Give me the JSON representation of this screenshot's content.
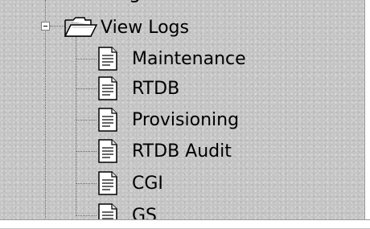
{
  "tree": {
    "clipped_above": "g",
    "folder": {
      "label": "View Logs",
      "icon": "open-folder-icon",
      "expander_icon": "collapse-minus-icon",
      "expanded": true
    },
    "items": [
      {
        "label": "Maintenance",
        "icon": "document-icon"
      },
      {
        "label": "RTDB",
        "icon": "document-icon"
      },
      {
        "label": "Provisioning",
        "icon": "document-icon"
      },
      {
        "label": "RTDB Audit",
        "icon": "document-icon"
      },
      {
        "label": "CGI",
        "icon": "document-icon"
      },
      {
        "label": "GS",
        "icon": "document-icon"
      }
    ]
  },
  "colors": {
    "background": "#c4c4c4",
    "text": "#000000",
    "tree_lines": "#6c6c6c"
  }
}
